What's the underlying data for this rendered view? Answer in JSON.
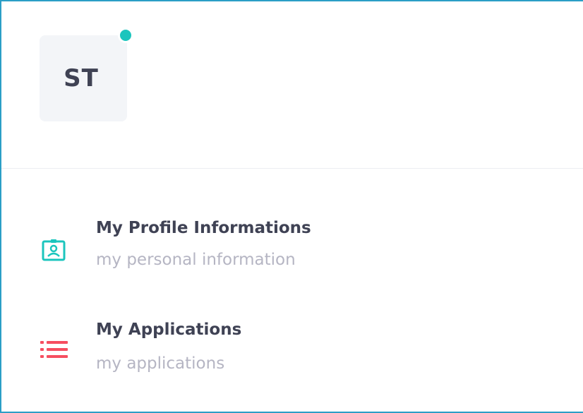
{
  "profile": {
    "initials": "ST",
    "status": "online"
  },
  "menu": {
    "items": [
      {
        "title": "My Profile Informations",
        "subtitle": "my personal information",
        "icon": "profile-card-icon",
        "icon_color": "#1bc5bd"
      },
      {
        "title": "My Applications",
        "subtitle": "my applications",
        "icon": "list-icon",
        "icon_color": "#f64e60"
      }
    ]
  },
  "colors": {
    "frame": "#2b9ec6",
    "status_online": "#1bc5bd",
    "text_primary": "#3f4254",
    "text_muted": "#b5b5c3",
    "avatar_bg": "#f3f5f8"
  }
}
